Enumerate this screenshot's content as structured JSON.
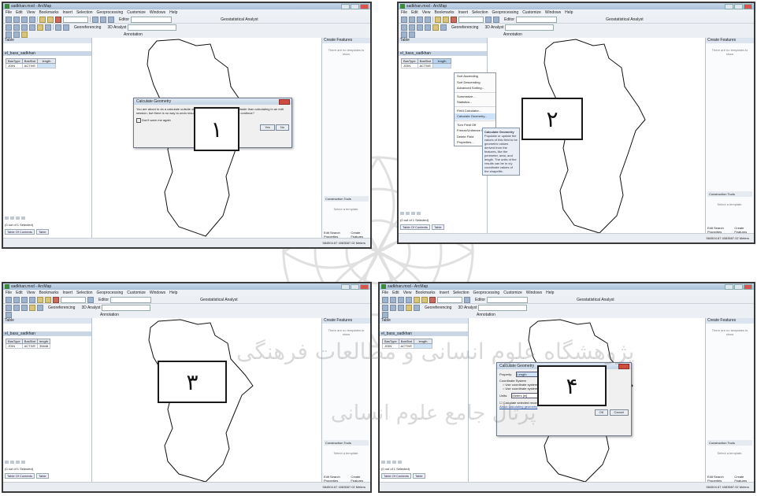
{
  "app": {
    "window_title": "sadkhan.mxd - ArcMap",
    "menu": [
      "File",
      "Edit",
      "View",
      "Bookmarks",
      "Insert",
      "Selection",
      "Geoprocessing",
      "Customize",
      "Windows",
      "Help"
    ],
    "toolbar": {
      "editor": "Editor",
      "georeferencing": "Georeferencing",
      "analyst_3d": "3D Analyst",
      "geostatistical": "Geostatistical Analyst",
      "annotation": "Annotation"
    },
    "table": {
      "pane_title": "Table",
      "tab_name": "el_bass_sadkhan",
      "columns": [
        "BasType",
        "BasStat",
        "length"
      ],
      "rows": [
        [
          "JOIN",
          "ACTIVE",
          ""
        ]
      ],
      "row_filled_length": "35848",
      "selection_text": "(0 out of 1 Selected)",
      "tab_label": "el_bass_sadkhan",
      "bottom_tabs": [
        "Table Of Contents",
        "Table"
      ]
    },
    "right_pane": {
      "title": "Create Features",
      "message": "There are no templates to show",
      "create_tools": "Construction Tools",
      "create_msg": "Select a template.",
      "tabs": [
        "Edit Search Properties",
        "Create Features"
      ]
    },
    "status": "584504.67 4083587.02 Meters"
  },
  "panel1": {
    "number": "۱",
    "dialog_title": "Calculate Geometry",
    "dialog_text": "You are about to do a calculate outside of an edit session. This method is faster than calculating in an edit session, but there is no way to undo results once you start. Do you wish to continue?",
    "checkbox": "Don't warn me again",
    "yes": "Yes",
    "no": "No"
  },
  "panel2": {
    "number": "۲",
    "menu_items": [
      "Sort Ascending",
      "Sort Descending",
      "Advanced Sorting...",
      "Summarize...",
      "Statistics...",
      "Field Calculator...",
      "Calculate Geometry...",
      "Turn Field Off",
      "Freeze/Unfreeze Column",
      "Delete Field",
      "Properties..."
    ],
    "tooltip_title": "Calculate Geometry",
    "tooltip_text": "Populate or update the values of this field to be geometric values derived from the features, like the perimeter, area, and length. The units of the results can be in x/y coordinate values of the shapefile."
  },
  "panel3": {
    "number": "۳"
  },
  "panel4": {
    "number": "۴",
    "dialog_title": "Calculate Geometry",
    "property_label": "Property:",
    "property_value": "Length",
    "coord_system": "Coordinate System",
    "use_source": "Use coordinate system of the data source:",
    "use_frame": "Use coordinate system of the data frame:",
    "units_label": "Units:",
    "units_value": "Meters [m]",
    "selected_only": "Calculate selected records only",
    "help_link": "About calculating geometry",
    "ok": "OK",
    "cancel": "Cancel"
  },
  "watermark": {
    "line1": "پژوهشگاه علوم انسانی و مطالعات فرهنگی",
    "line2": "پرتال جامع علوم انسانی"
  }
}
